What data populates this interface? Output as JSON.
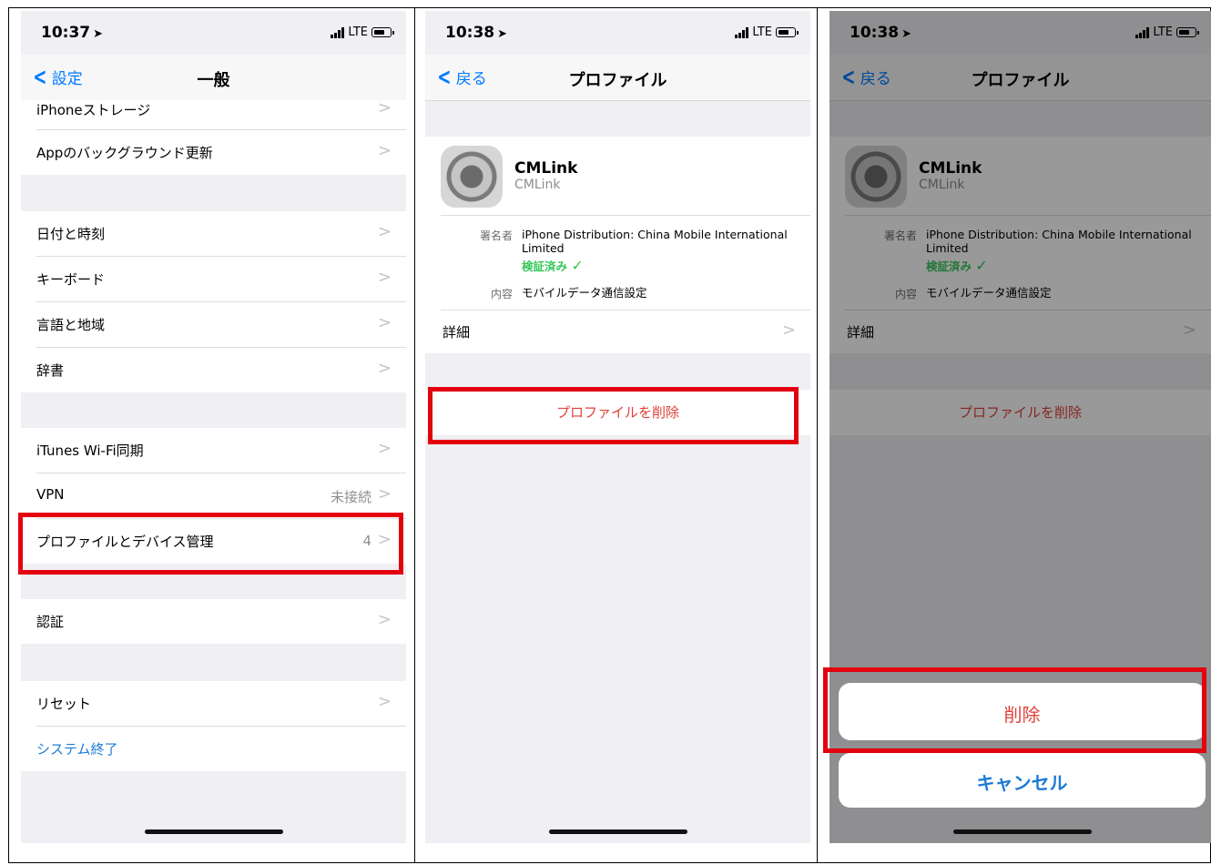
{
  "panel1": {
    "status": {
      "time": "10:37",
      "network": "LTE"
    },
    "nav": {
      "back": "設定",
      "title": "一般"
    },
    "rows_a": [
      {
        "label": "iPhoneストレージ"
      },
      {
        "label": "Appのバックグラウンド更新"
      }
    ],
    "rows_b": [
      {
        "label": "日付と時刻"
      },
      {
        "label": "キーボード"
      },
      {
        "label": "言語と地域"
      },
      {
        "label": "辞書"
      }
    ],
    "rows_c": [
      {
        "label": "iTunes Wi-Fi同期"
      },
      {
        "label": "VPN",
        "value": "未接続"
      },
      {
        "label": "プロファイルとデバイス管理",
        "value": "4"
      }
    ],
    "rows_d": [
      {
        "label": "認証"
      }
    ],
    "rows_e": [
      {
        "label": "リセット"
      },
      {
        "label": "システム終了"
      }
    ]
  },
  "panel2": {
    "status": {
      "time": "10:38",
      "network": "LTE"
    },
    "nav": {
      "back": "戻る",
      "title": "プロファイル"
    },
    "profile": {
      "name": "CMLink",
      "sub": "CMLink",
      "signer_label": "署名者",
      "signer_value": "iPhone Distribution: China Mobile International Limited",
      "verified": "検証済み",
      "content_label": "内容",
      "content_value": "モバイルデータ通信設定"
    },
    "details": "詳細",
    "delete_profile": "プロファイルを削除"
  },
  "panel3": {
    "status": {
      "time": "10:38",
      "network": "LTE"
    },
    "nav": {
      "back": "戻る",
      "title": "プロファイル"
    },
    "delete": "削除",
    "cancel": "キャンセル"
  },
  "colors": {
    "accent": "#007aff",
    "destructive": "#e0413a",
    "highlight": "#e3000f",
    "verified": "#34c759"
  }
}
